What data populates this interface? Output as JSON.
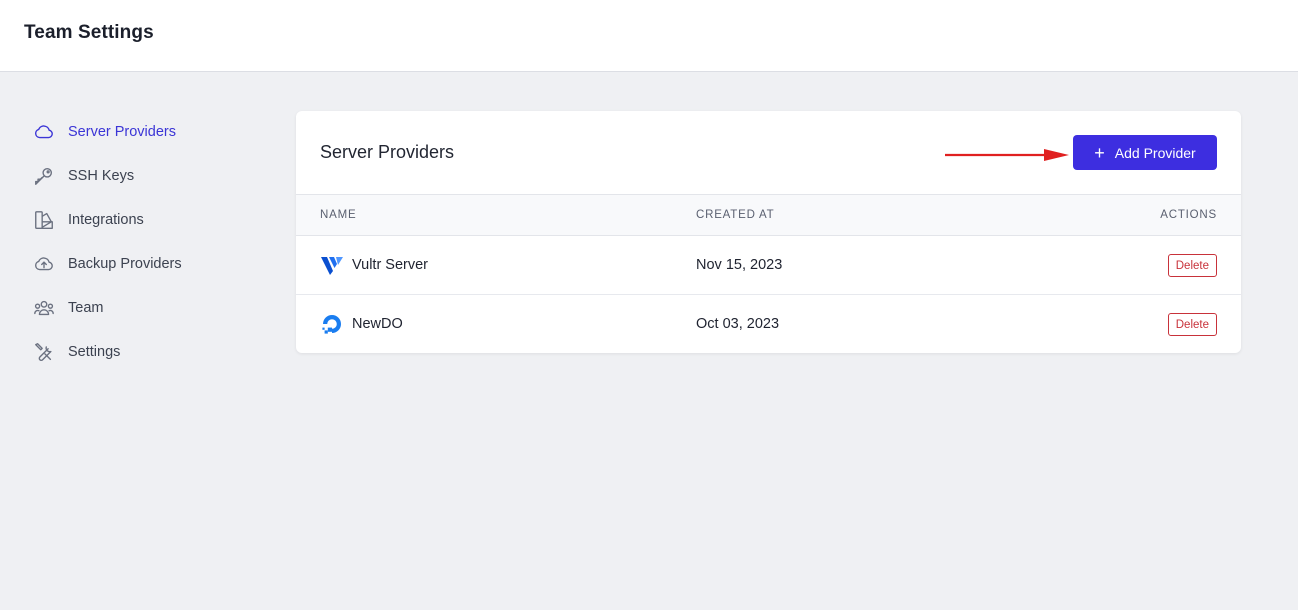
{
  "header": {
    "title": "Team Settings"
  },
  "sidebar": {
    "items": [
      {
        "label": "Server Providers",
        "icon": "cloud-icon",
        "active": true
      },
      {
        "label": "SSH Keys",
        "icon": "key-icon"
      },
      {
        "label": "Integrations",
        "icon": "integrations-icon"
      },
      {
        "label": "Backup Providers",
        "icon": "cloud-upload-icon"
      },
      {
        "label": "Team",
        "icon": "users-icon"
      },
      {
        "label": "Settings",
        "icon": "tools-icon"
      }
    ]
  },
  "card": {
    "title": "Server Providers",
    "add_button_label": "Add Provider",
    "columns": {
      "name": "NAME",
      "created_at": "CREATED AT",
      "actions": "ACTIONS"
    },
    "rows": [
      {
        "name": "Vultr Server",
        "created_at": "Nov 15, 2023",
        "action": "Delete",
        "logo": "vultr-logo-icon"
      },
      {
        "name": "NewDO",
        "created_at": "Oct 03, 2023",
        "action": "Delete",
        "logo": "digitalocean-logo-icon"
      }
    ]
  },
  "colors": {
    "accent": "#3d2ee0",
    "active_nav": "#3b35d6",
    "danger": "#c8323a",
    "annotation_arrow": "#e02020",
    "background": "#eff0f3"
  }
}
